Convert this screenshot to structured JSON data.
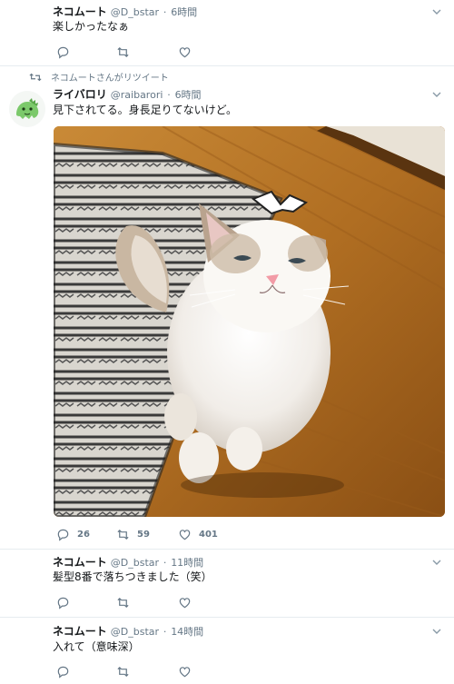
{
  "tweets": [
    {
      "name": "ネコムート",
      "handle": "@D_bstar",
      "sep": "·",
      "time": "6時間",
      "text": "楽しかったなぁ"
    },
    {
      "retweet_banner": "ネコムートさんがリツイート",
      "name": "ライバロリ",
      "handle": "@raibarori",
      "sep": "·",
      "time": "6時間",
      "text": "見下されてる。身長足りてないけど。",
      "reply_count": "26",
      "retweet_count": "59",
      "like_count": "401"
    },
    {
      "name": "ネコムート",
      "handle": "@D_bstar",
      "sep": "·",
      "time": "11時間",
      "text": "髪型8番で落ちつきました（笑）"
    },
    {
      "name": "ネコムート",
      "handle": "@D_bstar",
      "sep": "·",
      "time": "14時間",
      "text": "入れて（意味深）"
    }
  ],
  "icons": {
    "reply": "reply-icon",
    "retweet": "retweet-icon",
    "like": "like-icon",
    "caret": "chevron-down-icon"
  },
  "colors": {
    "icon_gray": "#657786",
    "divider": "#e6ecf0",
    "text": "#14171a"
  }
}
